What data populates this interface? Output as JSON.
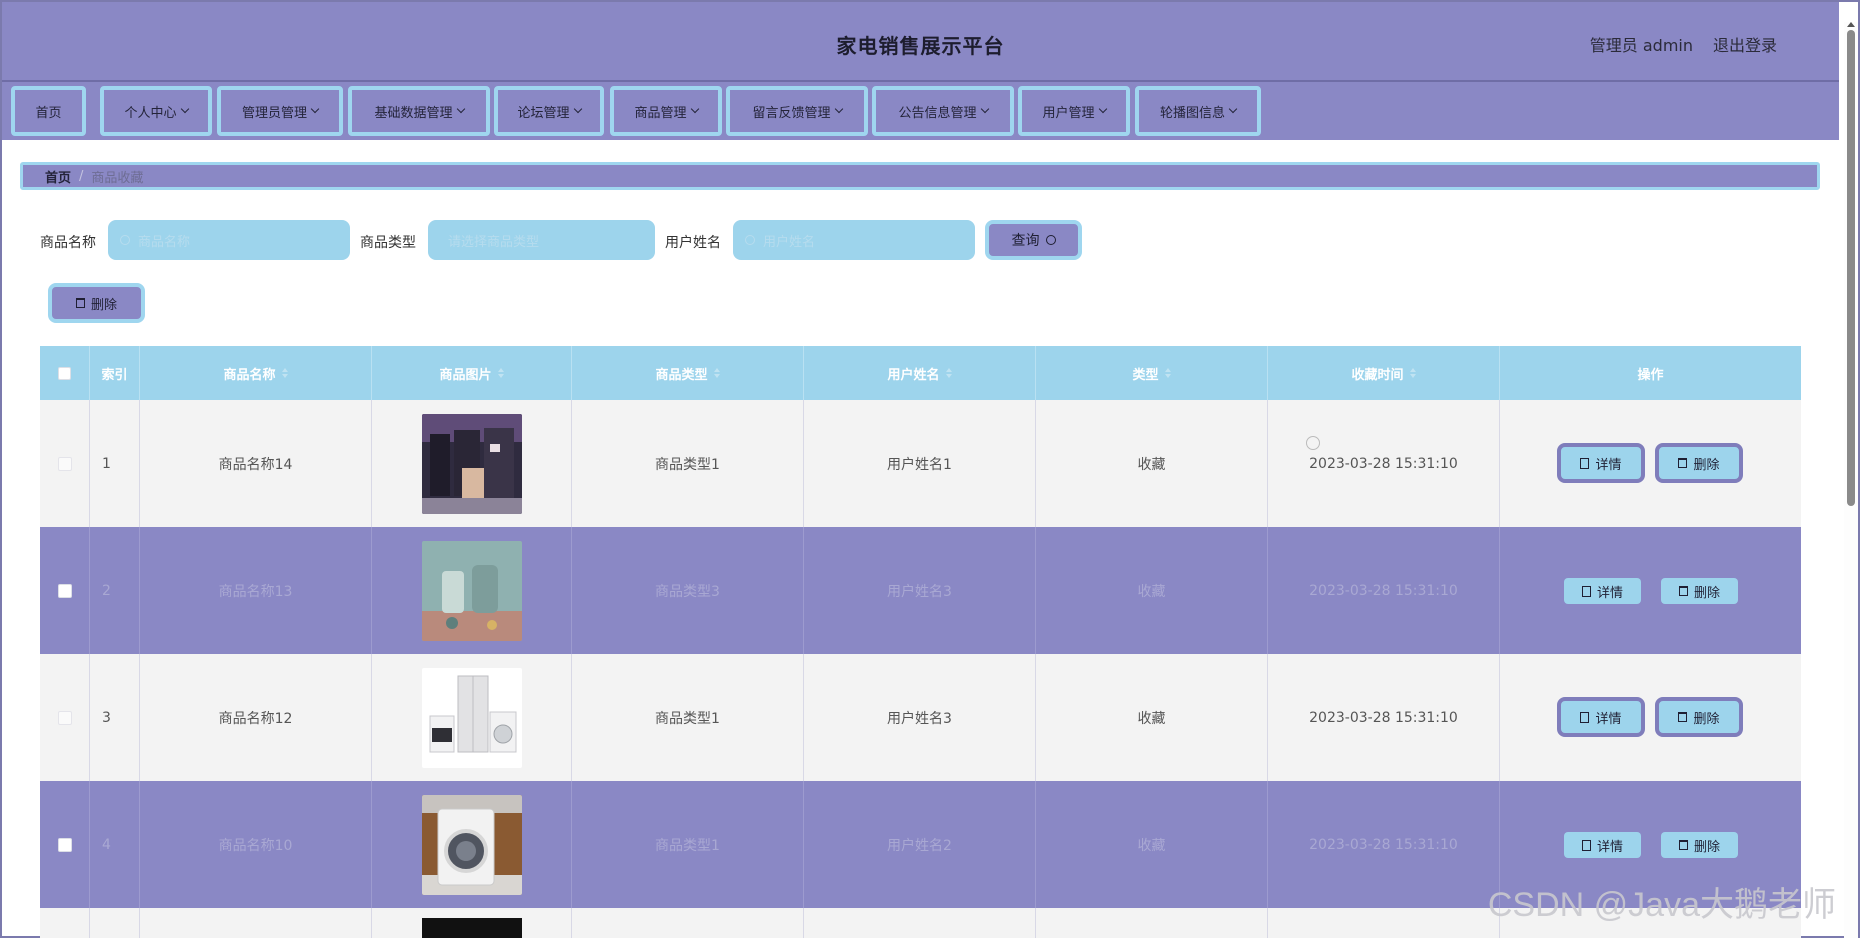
{
  "header": {
    "title": "家电销售展示平台",
    "user": "管理员 admin",
    "logout": "退出登录"
  },
  "nav": [
    {
      "label": "首页",
      "dropdown": false
    },
    {
      "label": "个人中心",
      "dropdown": true
    },
    {
      "label": "管理员管理",
      "dropdown": true
    },
    {
      "label": "基础数据管理",
      "dropdown": true
    },
    {
      "label": "论坛管理",
      "dropdown": true
    },
    {
      "label": "商品管理",
      "dropdown": true
    },
    {
      "label": "留言反馈管理",
      "dropdown": true
    },
    {
      "label": "公告信息管理",
      "dropdown": true
    },
    {
      "label": "用户管理",
      "dropdown": true
    },
    {
      "label": "轮播图信息",
      "dropdown": true
    }
  ],
  "breadcrumb": {
    "home": "首页",
    "current": "商品收藏"
  },
  "search": {
    "name_label": "商品名称",
    "name_placeholder": "商品名称",
    "type_label": "商品类型",
    "type_placeholder": "请选择商品类型",
    "user_label": "用户姓名",
    "user_placeholder": "用户姓名",
    "query_button": "查询"
  },
  "toolbar": {
    "delete_button": "删除"
  },
  "table": {
    "headers": [
      "索引",
      "商品名称",
      "商品图片",
      "商品类型",
      "用户姓名",
      "类型",
      "收藏时间",
      "操作"
    ],
    "rows": [
      {
        "index": "1",
        "name": "商品名称14",
        "image": "kitchen-appliances-photo",
        "type": "商品类型1",
        "user": "用户姓名1",
        "kind": "收藏",
        "time": "2023-03-28 15:31:10"
      },
      {
        "index": "2",
        "name": "商品名称13",
        "image": "kettle-set-photo",
        "type": "商品类型3",
        "user": "用户姓名3",
        "kind": "收藏",
        "time": "2023-03-28 15:31:10"
      },
      {
        "index": "3",
        "name": "商品名称12",
        "image": "white-appliances-photo",
        "type": "商品类型1",
        "user": "用户姓名3",
        "kind": "收藏",
        "time": "2023-03-28 15:31:10"
      },
      {
        "index": "4",
        "name": "商品名称10",
        "image": "washing-machine-photo",
        "type": "商品类型1",
        "user": "用户姓名2",
        "kind": "收藏",
        "time": "2023-03-28 15:31:10"
      }
    ],
    "detail_button": "详情",
    "delete_button": "删除"
  },
  "watermark": "CSDN @Java大鹅老师",
  "colors": {
    "primary": "#8a88c5",
    "accent": "#9dd4ec",
    "row_light": "#f3f3f3"
  }
}
